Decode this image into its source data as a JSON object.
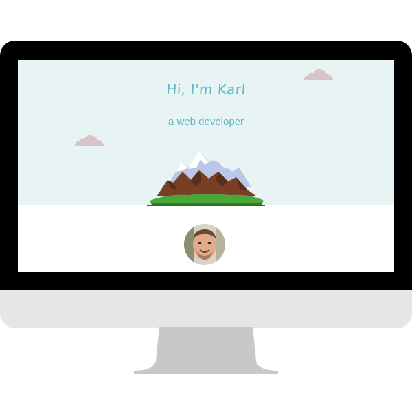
{
  "hero": {
    "title": "Hi, I'm Karl",
    "subtitle": "a web developer"
  },
  "icons": {
    "clouds": "cloud-icon",
    "mountain": "mountain-illustration",
    "avatar": "profile-photo"
  },
  "colors": {
    "accent": "#5bbbc2",
    "hero_background": "#e8f4f4",
    "cloud": "#d8c4c8",
    "monitor_bezel": "#000000",
    "monitor_chin": "#e6e6e6",
    "stand": "#c8c8c8"
  }
}
